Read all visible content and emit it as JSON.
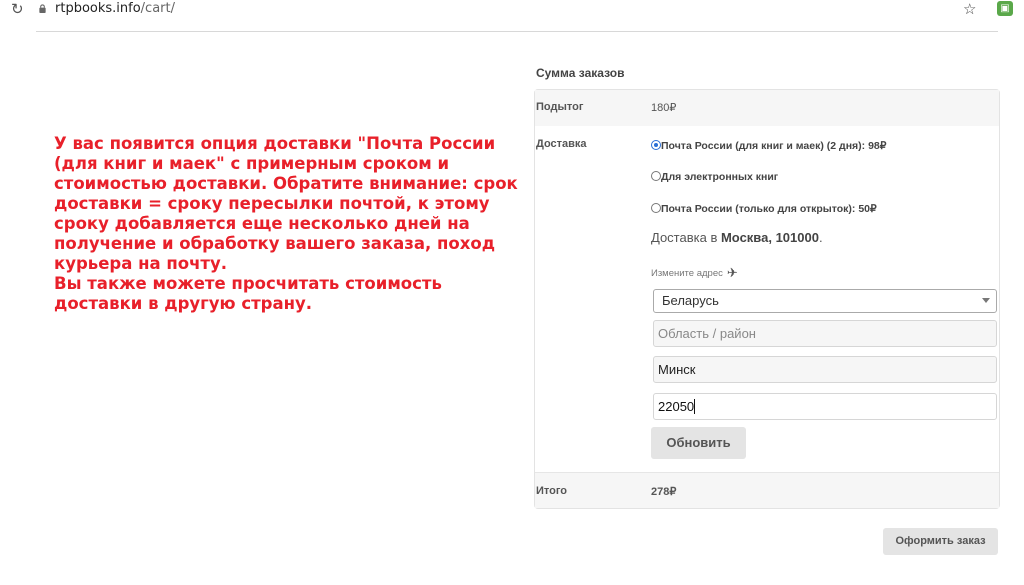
{
  "browser": {
    "url_host": "rtpbooks.info",
    "url_path": "/cart/",
    "reload_icon": "reload-icon",
    "star_icon": "star-icon"
  },
  "annotation": {
    "text": "У вас появится опция доставки \"Почта России (для книг и маек\" с примерным сроком и стоимостью доставки. Обратите внимание: срок доставки = сроку пересылки почтой, к этому сроку добавляется еще несколько дней на получение и обработку вашего заказа, поход курьера на почту.\nВы также можете просчитать стоимость доставки в другую страну.",
    "color": "#e8202a"
  },
  "totals": {
    "title": "Сумма заказов",
    "subtotal_label": "Подытог",
    "subtotal_value": "180₽",
    "shipping_label": "Доставка",
    "shipping_options": [
      {
        "label": "Почта России (для книг и маек) (2 дня): 98₽",
        "checked": true
      },
      {
        "label": "Для электронных книг",
        "checked": false
      },
      {
        "label": "Почта России (только для открыток): 50₽",
        "checked": false
      }
    ],
    "destination_prefix": "Доставка в ",
    "destination_value": "Москва, 101000",
    "destination_suffix": ".",
    "change_address": "Измените адрес",
    "country_select": "Беларусь",
    "region_placeholder": "Область / район",
    "city_value": "Минск",
    "postal_value": "22050",
    "update_button": "Обновить",
    "total_label": "Итого",
    "total_value": "278₽"
  },
  "checkout_button": "Оформить заказ"
}
